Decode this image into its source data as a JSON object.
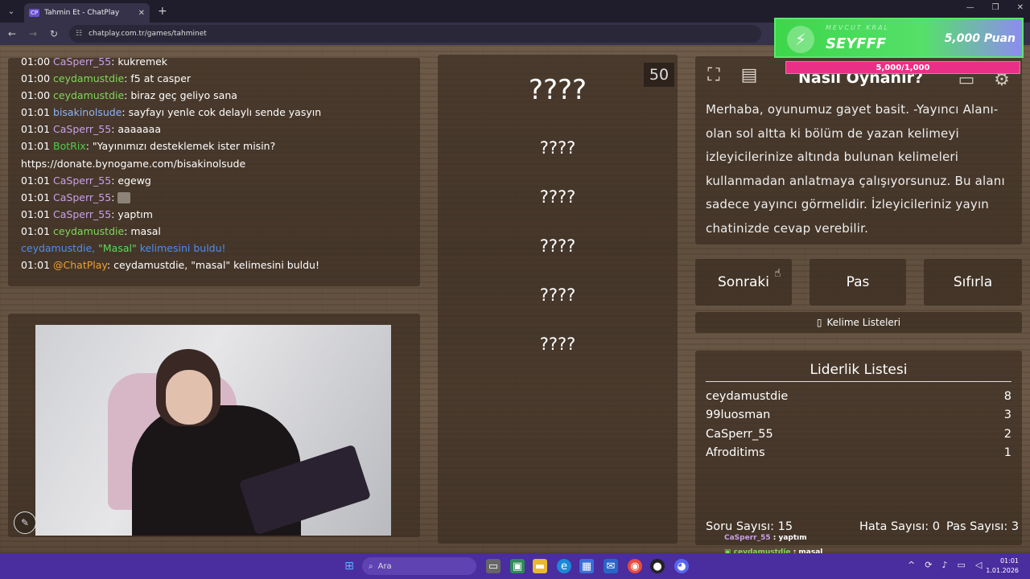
{
  "browser": {
    "tab_favicon": "CP",
    "tab_title": "Tahmin Et - ChatPlay",
    "url": "chatplay.com.tr/games/tahminet"
  },
  "chat": {
    "lines": [
      {
        "time": "01:00",
        "user": "CaSperr_55",
        "user_class": "u-casperr",
        "text": ": kukremek"
      },
      {
        "time": "01:00",
        "user": "ceydamustdie",
        "user_class": "u-ceyda",
        "text": ": f5 at casper"
      },
      {
        "time": "01:00",
        "user": "ceydamustdie",
        "user_class": "u-ceyda",
        "text": ": biraz geç geliyo sana"
      },
      {
        "time": "01:01",
        "user": "bisakinolsude",
        "user_class": "u-bisa",
        "text": ": sayfayı yenle cok delaylı sende yasyın"
      },
      {
        "time": "01:01",
        "user": "CaSperr_55",
        "user_class": "u-casperr",
        "text": ": aaaaaaa"
      },
      {
        "time": "01:01",
        "user": "BotRix",
        "user_class": "u-botrix",
        "text": ": \"Yayınımızı desteklemek ister misin?"
      },
      {
        "time": "",
        "user": "",
        "user_class": "",
        "text": "https://donate.bynogame.com/bisakinolsude"
      },
      {
        "time": "01:01",
        "user": "CaSperr_55",
        "user_class": "u-casperr",
        "text": ": egewg"
      },
      {
        "time": "01:01",
        "user": "CaSperr_55",
        "user_class": "u-casperr",
        "text": ": "
      },
      {
        "time": "01:01",
        "user": "CaSperr_55",
        "user_class": "u-casperr",
        "text": ": yaptım"
      },
      {
        "time": "01:01",
        "user": "ceydamustdie",
        "user_class": "u-ceyda",
        "text": ": masal"
      }
    ],
    "system_line": {
      "user": "ceydamustdie,",
      "word": "\"Masal\"",
      "text": " kelimesini buldu!"
    },
    "last_line": {
      "time": "01:01",
      "user": "@ChatPlay",
      "text": ": ceydamustdie, \"masal\" kelimesini buldu!"
    }
  },
  "game": {
    "score": "50",
    "main_word": "????",
    "taboo_words": [
      "????",
      "????",
      "????",
      "????",
      "????"
    ]
  },
  "howto": {
    "title": "Nasıl Oynanır?",
    "text": "Merhaba, oyunumuz gayet basit. -Yayıncı Alanı- olan sol altta ki bölüm de yazan kelimeyi izleyicilerinize altında bulunan kelimeleri kullanmadan anlatmaya çalışıyorsunuz. Bu alanı sadece yayıncı görmelidir. İzleyicileriniz yayın chatinizde cevap verebilir."
  },
  "controls": {
    "next": "Sonraki",
    "pass": "Pas",
    "reset": "Sıfırla",
    "word_lists": "Kelime Listeleri"
  },
  "leaderboard": {
    "title": "Liderlik Listesi",
    "rows": [
      {
        "name": "ceydamustdie",
        "score": "8"
      },
      {
        "name": "99luosman",
        "score": "3"
      },
      {
        "name": "CaSperr_55",
        "score": "2"
      },
      {
        "name": "Afroditims",
        "score": "1"
      }
    ],
    "question_count": "Soru Sayısı: 15",
    "error_count": "Hata Sayısı: 0",
    "pass_count": "Pas Sayısı: 3"
  },
  "overlay": {
    "kral_label": "MEVCUT KRAL",
    "kral_name": "SEYFFF",
    "kral_points": "5,000 Puan",
    "kral_progress": "5,000/1,000",
    "mini_chat": [
      {
        "user": "CaSperr_55",
        "text": " : yaptım",
        "color": "#c9a0e8"
      },
      {
        "user": "ceydamustdie",
        "text": " : masal",
        "color": "#7ed957"
      }
    ]
  },
  "taskbar": {
    "search_label": "Ara",
    "time": "01:01",
    "date": "1.01.2026"
  },
  "icons": {
    "menu": "chevron-down-icon",
    "fullscreen": "expand-icon",
    "notes": "notes-icon",
    "settings": "gear-icon",
    "edit": "pencil-icon",
    "lightning": "bolt-icon"
  }
}
